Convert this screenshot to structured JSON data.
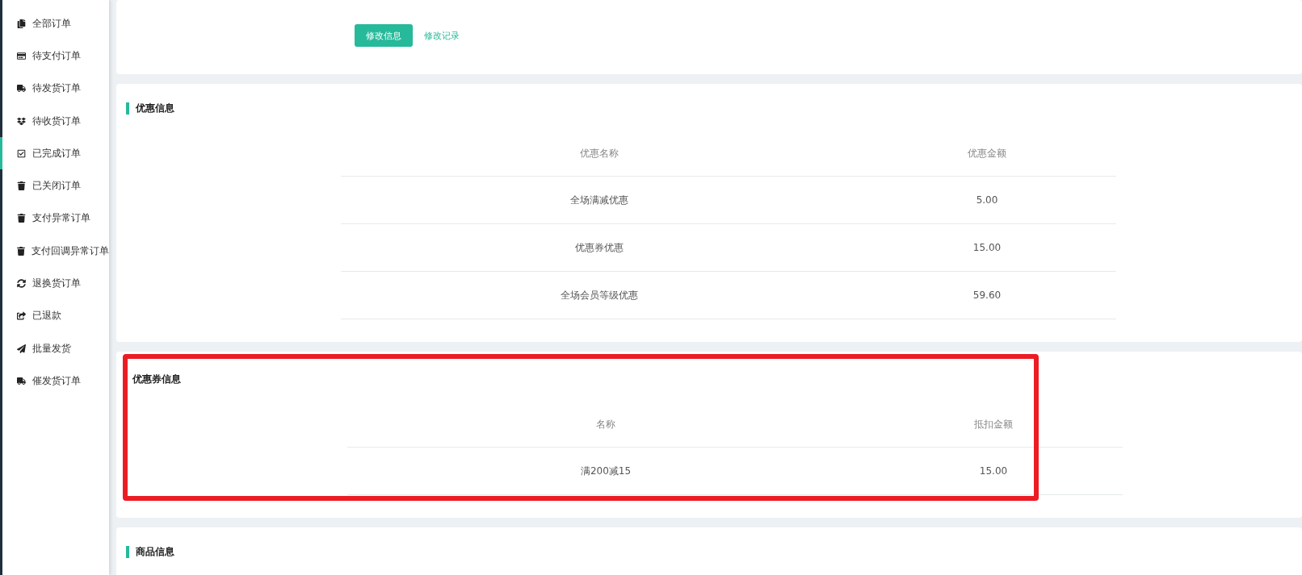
{
  "sidebar": {
    "items": [
      {
        "label": "全部订单",
        "selected": false
      },
      {
        "label": "待支付订单",
        "selected": false
      },
      {
        "label": "待发货订单",
        "selected": false
      },
      {
        "label": "待收货订单",
        "selected": false
      },
      {
        "label": "已完成订单",
        "selected": true
      },
      {
        "label": "已关闭订单",
        "selected": false
      },
      {
        "label": "支付异常订单",
        "selected": false
      },
      {
        "label": "支付回调异常订单",
        "selected": false
      },
      {
        "label": "退换货订单",
        "selected": false
      },
      {
        "label": "已退款",
        "selected": false
      },
      {
        "label": "批量发货",
        "selected": false
      },
      {
        "label": "催发货订单",
        "selected": false
      }
    ]
  },
  "actions": {
    "primary": "修改信息",
    "link": "修改记录"
  },
  "sections": [
    {
      "title": "优惠信息",
      "highlighted": false,
      "columns": [
        "优惠名称",
        "优惠金额"
      ],
      "rows": [
        [
          "全场满减优惠",
          "5.00"
        ],
        [
          "优惠券优惠",
          "15.00"
        ],
        [
          "全场会员等级优惠",
          "59.60"
        ]
      ]
    },
    {
      "title": "优惠券信息",
      "highlighted": true,
      "columns": [
        "名称",
        "抵扣金额"
      ],
      "rows": [
        [
          "满200减15",
          "15.00"
        ]
      ]
    },
    {
      "title": "商品信息",
      "highlighted": false
    }
  ]
}
